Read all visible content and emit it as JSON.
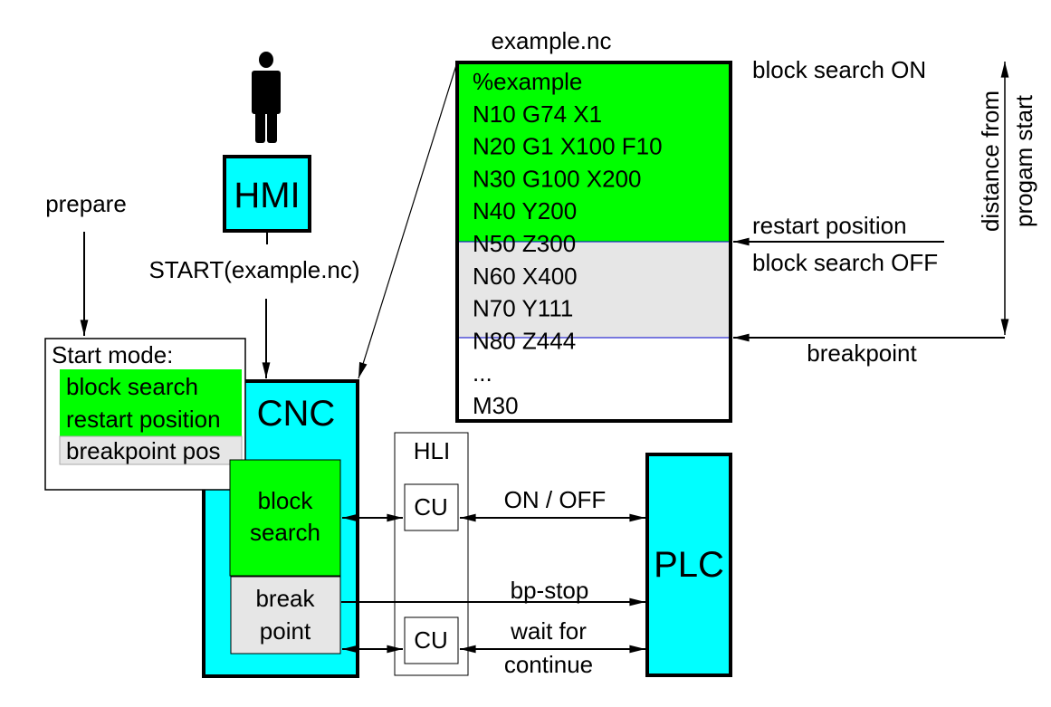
{
  "colors": {
    "cyan": "#00ffff",
    "green": "#00ff00",
    "gray": "#e6e6e6",
    "blue_line": "#0000cc",
    "black": "#000000"
  },
  "user_icon": "person-icon",
  "hmi": {
    "label": "HMI"
  },
  "start_command": "START(example.nc)",
  "prepare_label": "prepare",
  "start_mode": {
    "title": "Start mode:",
    "options": [
      {
        "label": "block search",
        "state": "active"
      },
      {
        "label": "restart position",
        "state": "active"
      },
      {
        "label": "breakpoint pos",
        "state": "inactive"
      }
    ]
  },
  "cnc": {
    "label": "CNC",
    "block_search": [
      "block",
      "search"
    ],
    "breakpoint": [
      "break",
      "point"
    ]
  },
  "hli": {
    "label": "HLI",
    "cu_top": "CU",
    "cu_bottom": "CU"
  },
  "plc": {
    "label": "PLC"
  },
  "signals": {
    "on_off": "ON / OFF",
    "bp_stop": "bp-stop",
    "wait_for": "wait for",
    "continue": "continue"
  },
  "program": {
    "filename": "example.nc",
    "lines": [
      {
        "text": "%example",
        "zone": "search"
      },
      {
        "text": "N10 G74 X1",
        "zone": "search"
      },
      {
        "text": "N20 G1 X100 F10",
        "zone": "search"
      },
      {
        "text": "N30 G100 X200",
        "zone": "search"
      },
      {
        "text": "N40 Y200",
        "zone": "search"
      },
      {
        "text": "N50 Z300",
        "zone": "restart"
      },
      {
        "text": "N60 X400",
        "zone": "run"
      },
      {
        "text": "N70 Y111",
        "zone": "run"
      },
      {
        "text": "N80 Z444",
        "zone": "breakpoint"
      },
      {
        "text": "...",
        "zone": "after"
      },
      {
        "text": "M30",
        "zone": "after"
      }
    ]
  },
  "annotations": {
    "block_search_on": "block search ON",
    "restart_position": "restart position",
    "block_search_off": "block search OFF",
    "breakpoint": "breakpoint",
    "distance_line1": "distance from",
    "distance_line2": "progam start"
  }
}
